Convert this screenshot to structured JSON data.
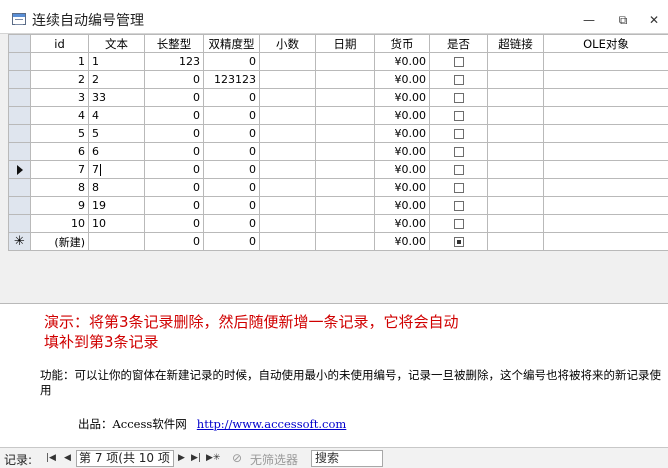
{
  "window": {
    "title": "连续自动编号管理",
    "minimize_glyph": "—",
    "restore_glyph": "⧉",
    "close_glyph": "✕"
  },
  "table": {
    "columns": [
      "id",
      "文本",
      "长整型",
      "双精度型",
      "小数",
      "日期",
      "货币",
      "是否",
      "超链接",
      "OLE对象"
    ],
    "rows": [
      {
        "id": "1",
        "text": "1",
        "long": "123",
        "double": "0",
        "decimal": "",
        "date": "",
        "currency": "¥0.00",
        "checked": false,
        "current": false
      },
      {
        "id": "2",
        "text": "2",
        "long": "0",
        "double": "123123",
        "decimal": "",
        "date": "",
        "currency": "¥0.00",
        "checked": false,
        "current": false
      },
      {
        "id": "3",
        "text": "33",
        "long": "0",
        "double": "0",
        "decimal": "",
        "date": "",
        "currency": "¥0.00",
        "checked": false,
        "current": false
      },
      {
        "id": "4",
        "text": "4",
        "long": "0",
        "double": "0",
        "decimal": "",
        "date": "",
        "currency": "¥0.00",
        "checked": false,
        "current": false
      },
      {
        "id": "5",
        "text": "5",
        "long": "0",
        "double": "0",
        "decimal": "",
        "date": "",
        "currency": "¥0.00",
        "checked": false,
        "current": false
      },
      {
        "id": "6",
        "text": "6",
        "long": "0",
        "double": "0",
        "decimal": "",
        "date": "",
        "currency": "¥0.00",
        "checked": false,
        "current": false
      },
      {
        "id": "7",
        "text": "7",
        "long": "0",
        "double": "0",
        "decimal": "",
        "date": "",
        "currency": "¥0.00",
        "checked": false,
        "current": true
      },
      {
        "id": "8",
        "text": "8",
        "long": "0",
        "double": "0",
        "decimal": "",
        "date": "",
        "currency": "¥0.00",
        "checked": false,
        "current": false
      },
      {
        "id": "9",
        "text": "19",
        "long": "0",
        "double": "0",
        "decimal": "",
        "date": "",
        "currency": "¥0.00",
        "checked": false,
        "current": false
      },
      {
        "id": "10",
        "text": "10",
        "long": "0",
        "double": "0",
        "decimal": "",
        "date": "",
        "currency": "¥0.00",
        "checked": false,
        "current": false
      }
    ],
    "new_row": {
      "marker": "✳",
      "id": "(新建)",
      "long": "0",
      "double": "0",
      "currency": "¥0.00",
      "checked": true
    }
  },
  "form": {
    "demo_line1": "演示：将第3条记录删除，然后随便新增一条记录，它将会自动",
    "demo_line2": "填补到第3条记录",
    "desc": "功能：可以让你的窗体在新建记录的时候，自动使用最小的未使用编号，记录一旦被删除，这个编号也将被将来的新记录使用",
    "credit_label": "出品：Access软件网",
    "credit_link": "http://www.accessoft.com"
  },
  "navbar": {
    "label": "记录:",
    "first": "|◀",
    "prev": "◀",
    "record_text": "第 7 项(共 10 项",
    "next": "▶",
    "last": "▶|",
    "new": "▶✳",
    "filter": "无筛选器",
    "search": "搜索"
  }
}
